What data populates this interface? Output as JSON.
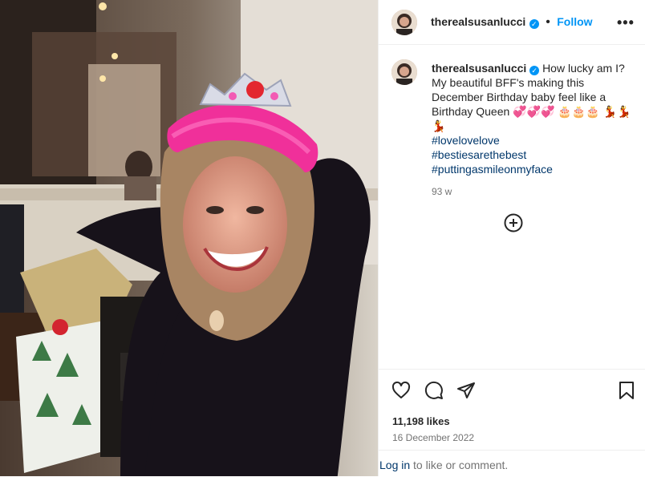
{
  "post": {
    "username": "therealsusanlucci",
    "follow_label": "Follow",
    "caption_text": "How lucky am I? My beautiful BFF's making this December Birthday baby feel like a Birthday Queen 💞💞💞 🎂🎂🎂 💃💃💃",
    "hashtags": [
      "#lovelovelove",
      "#bestiesarethebest",
      "#puttingasmileonmyface"
    ],
    "caption_time": "93 w",
    "likes": "11,198 likes",
    "date": "16 December 2022",
    "login_link": "Log in",
    "login_suffix": " to like or comment."
  },
  "icons": [
    "verified-badge-icon",
    "more-options-icon",
    "load-more-comments-icon",
    "heart-icon",
    "comment-icon",
    "share-icon",
    "save-bookmark-icon"
  ],
  "colors": {
    "link": "#0095f6",
    "hashtag": "#00376b",
    "muted": "#737373",
    "text": "#262626"
  }
}
